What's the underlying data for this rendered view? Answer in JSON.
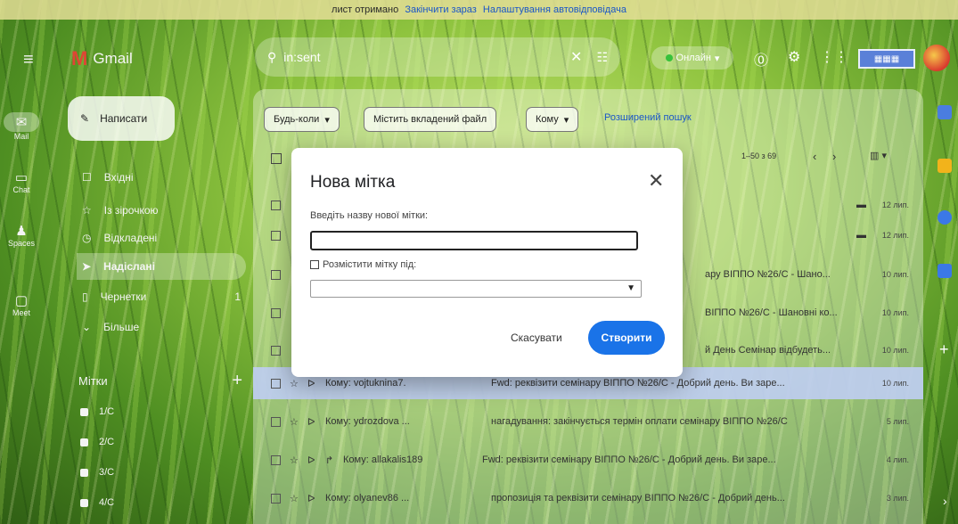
{
  "notice": {
    "text": "лист отримано",
    "link_finish": "Закінчити зараз",
    "link_settings": "Налаштування автовідповідача"
  },
  "app": {
    "name": "Gmail"
  },
  "search": {
    "value": "in:sent"
  },
  "status": {
    "label": "Онлайн"
  },
  "rail": {
    "mail": "Mail",
    "chat": "Chat",
    "spaces": "Spaces",
    "meet": "Meet"
  },
  "compose": {
    "label": "Написати"
  },
  "nav": [
    {
      "label": "Вхідні"
    },
    {
      "label": "Із зірочкою"
    },
    {
      "label": "Відкладені"
    },
    {
      "label": "Надіслані"
    },
    {
      "label": "Чернетки",
      "count": "1"
    },
    {
      "label": "Більше"
    }
  ],
  "labels": {
    "title": "Мітки",
    "items": [
      "1/С",
      "2/С",
      "3/С",
      "4/С"
    ]
  },
  "filters": {
    "any_time": "Будь-коли",
    "has_attachment": "Містить вкладений файл",
    "to": "Кому",
    "advanced": "Розширений пошук"
  },
  "pager": {
    "text": "1–50 з 69"
  },
  "rows": [
    {
      "subject": "",
      "time": "12 лип."
    },
    {
      "subject": "",
      "time": "12 лип."
    },
    {
      "subject": "ару ВІППО №26/С - Шано...",
      "time": "10 лип."
    },
    {
      "subject": "ВІППО №26/С - Шановні ко...",
      "time": "10 лип."
    },
    {
      "subject": "й День Семінар відбудеть...",
      "time": "10 лип."
    },
    {
      "sender": "Кому: vojtuknina7.",
      "subject": "Fwd: реквізити семінару ВІППО №26/С - Добрий день. Ви заре...",
      "time": "10 лип."
    },
    {
      "sender": "Кому: ydrozdova ...",
      "subject": "нагадування: закінчується термін оплати семінару ВІППО №26/С",
      "time": "5 лип."
    },
    {
      "sender": "Кому: allakalis189",
      "subject": "Fwd: реквізити семінару ВІППО №26/С - Добрий день. Ви заре...",
      "time": "4 лип."
    },
    {
      "sender": "Кому: olyanev86 ...",
      "subject": "пропозиція та реквізити семінару ВІППО №26/С - Добрий день...",
      "time": "3 лип."
    }
  ],
  "dialog": {
    "title": "Нова мітка",
    "name_label": "Введіть назву нової мітки:",
    "name_value": "",
    "nest_label": "Розмістити мітку під:",
    "cancel": "Скасувати",
    "create": "Створити"
  },
  "colors": {
    "primary_button": "#1a73e8",
    "selected_row": "#bccdf0",
    "notice_bar": "#e4de96"
  }
}
